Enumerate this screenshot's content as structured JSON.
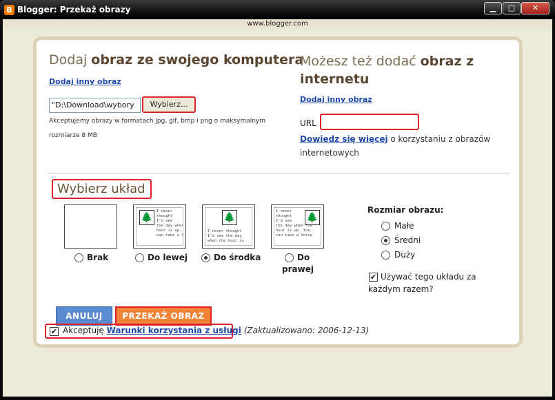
{
  "window": {
    "title": "Blogger: Przekaż obrazy",
    "logo": "B",
    "url": "www.blogger.com",
    "min_glyph": "▁",
    "max_glyph": "□",
    "close_glyph": "✕"
  },
  "computer": {
    "heading_light": "Dodaj ",
    "heading_bold": "obraz ze swojego komputera",
    "add_another": "Dodaj inny obraz",
    "file_value": "\"D:\\Download\\wybory",
    "browse_label": "Wybierz...",
    "formats_text": "Akceptujemy obrazy w formatach jpg, gif, bmp i png o maksymalnym",
    "size_text": "rozmiarze 8 MB"
  },
  "internet": {
    "heading_light": "Możesz też dodać ",
    "heading_bold": "obraz z internetu",
    "add_another": "Dodaj inny obraz",
    "url_label": "URL",
    "url_value": "",
    "learn_link": "Dowiedz się więcej",
    "learn_text": " o korzystaniu z obrazów internetowych"
  },
  "layout": {
    "title": "Wybierz układ",
    "thumb_text_left": "I never\nthought\nI'd see\nthe day when the\nhour is up. You\ncan take a horse",
    "thumb_text_center": "I never thought\nI'd see the day\nwhen the hour is",
    "options": [
      {
        "label": "Brak",
        "checked": false
      },
      {
        "label": "Do lewej",
        "checked": false
      },
      {
        "label": "Do środka",
        "checked": true
      },
      {
        "label": "Do",
        "label2": "prawej",
        "checked": false
      }
    ]
  },
  "size": {
    "heading": "Rozmiar obrazu:",
    "options": [
      {
        "label": "Małe",
        "checked": false
      },
      {
        "label": "Średni",
        "checked": true
      },
      {
        "label": "Duży",
        "checked": false
      }
    ],
    "remember_label": "Używać tego układu za każdym razem?",
    "remember_checked": true
  },
  "actions": {
    "cancel_label": "ANULUJ",
    "submit_label": "PRZEKAŻ OBRAZ",
    "accept_prefix": "Akceptuję ",
    "accept_link": "Warunki korzystania z usługi",
    "accept_updated": " (Zaktualizowano: 2006-12-13)",
    "accept_checked": true
  },
  "icons": {
    "tree": "🌲",
    "check": "✔"
  }
}
